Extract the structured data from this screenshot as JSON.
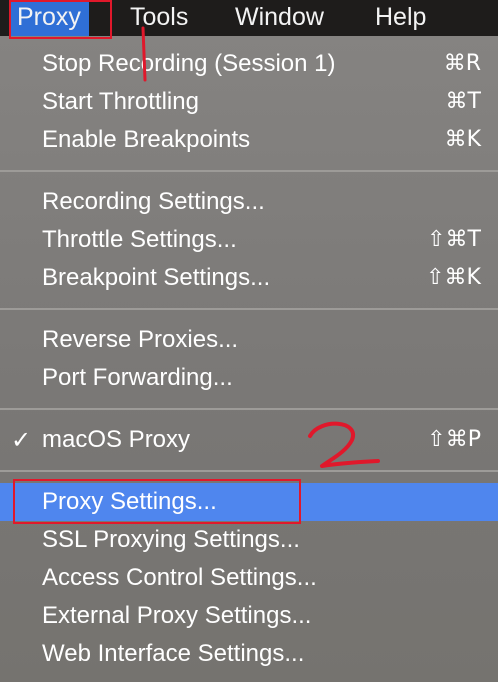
{
  "menubar": {
    "items": [
      {
        "label": "Proxy"
      },
      {
        "label": "Tools"
      },
      {
        "label": "Window"
      },
      {
        "label": "Help"
      }
    ]
  },
  "menu": {
    "groups": [
      [
        {
          "label": "Stop Recording (Session 1)",
          "shortcut": "⌘R"
        },
        {
          "label": "Start Throttling",
          "shortcut": "⌘T"
        },
        {
          "label": "Enable Breakpoints",
          "shortcut": "⌘K"
        }
      ],
      [
        {
          "label": "Recording Settings...",
          "shortcut": ""
        },
        {
          "label": "Throttle Settings...",
          "shortcut": "⇧⌘T"
        },
        {
          "label": "Breakpoint Settings...",
          "shortcut": "⇧⌘K"
        }
      ],
      [
        {
          "label": "Reverse Proxies...",
          "shortcut": ""
        },
        {
          "label": "Port Forwarding...",
          "shortcut": ""
        }
      ],
      [
        {
          "label": "macOS Proxy",
          "shortcut": "⇧⌘P",
          "checked": true,
          "check": "✓"
        }
      ],
      [
        {
          "label": "Proxy Settings...",
          "shortcut": "",
          "highlighted": true
        },
        {
          "label": "SSL Proxying Settings...",
          "shortcut": ""
        },
        {
          "label": "Access Control Settings...",
          "shortcut": ""
        },
        {
          "label": "External Proxy Settings...",
          "shortcut": ""
        },
        {
          "label": "Web Interface Settings...",
          "shortcut": ""
        }
      ]
    ]
  },
  "annotation": {
    "color": "#e0182b",
    "step_mark": "2"
  },
  "colors": {
    "menubar_bg": "#1e1c1b",
    "menubar_active": "#2f6fd6",
    "menu_bg": "#7a7876",
    "highlight": "#4f86ee",
    "annotation": "#e0182b"
  }
}
